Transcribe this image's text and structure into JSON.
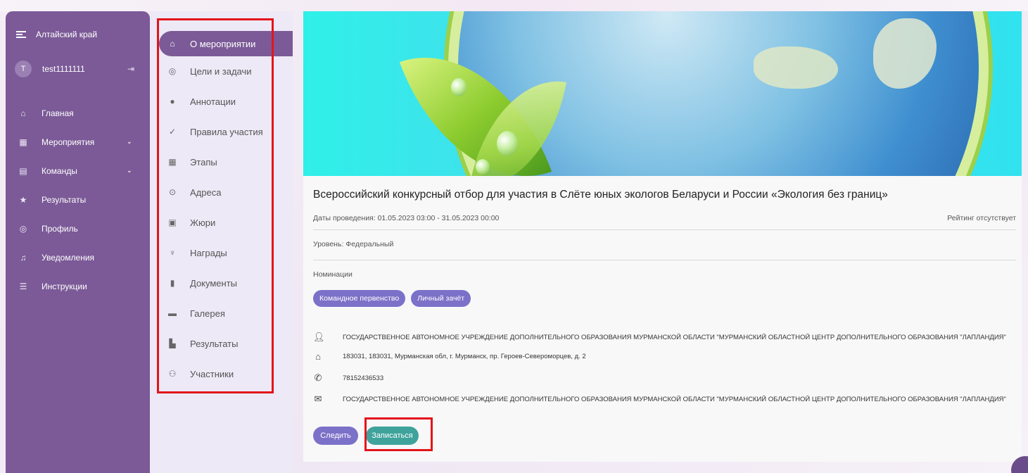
{
  "sidebar": {
    "region": "Алтайский край",
    "user": {
      "initial": "T",
      "name": "test1111111"
    },
    "items": [
      {
        "label": "Главная",
        "icon": "home-outline-icon"
      },
      {
        "label": "Мероприятия",
        "icon": "calendar-icon",
        "has_chevron": true
      },
      {
        "label": "Команды",
        "icon": "document-icon",
        "has_chevron": true
      },
      {
        "label": "Результаты",
        "icon": "star-person-icon"
      },
      {
        "label": "Профиль",
        "icon": "profile-icon"
      },
      {
        "label": "Уведомления",
        "icon": "bell-icon"
      },
      {
        "label": "Инструкции",
        "icon": "list-icon"
      }
    ]
  },
  "event_menu": {
    "items": [
      {
        "label": "О мероприятии",
        "icon": "home-icon",
        "active": true
      },
      {
        "label": "Цели и задачи",
        "icon": "target-icon"
      },
      {
        "label": "Аннотации",
        "icon": "info-icon"
      },
      {
        "label": "Правила участия",
        "icon": "check-icon"
      },
      {
        "label": "Этапы",
        "icon": "stages-icon"
      },
      {
        "label": "Адреса",
        "icon": "location-icon"
      },
      {
        "label": "Жюри",
        "icon": "jury-icon"
      },
      {
        "label": "Награды",
        "icon": "trophy-icon"
      },
      {
        "label": "Документы",
        "icon": "file-icon"
      },
      {
        "label": "Галерея",
        "icon": "image-icon"
      },
      {
        "label": "Результаты",
        "icon": "chart-icon"
      },
      {
        "label": "Участники",
        "icon": "people-icon"
      }
    ]
  },
  "event": {
    "title": "Всероссийский конкурсный отбор для участия в Слёте юных экологов Беларуси и России «Экология без границ»",
    "dates": "Даты проведения: 01.05.2023 03:00 - 31.05.2023 00:00",
    "rating": "Рейтинг отсутствует",
    "level": "Уровень: Федеральный",
    "nominations_label": "Номинации",
    "nominations": [
      "Командное первенство",
      "Личный зачёт"
    ],
    "organizer": "ГОСУДАРСТВЕННОЕ АВТОНОМНОЕ УЧРЕЖДЕНИЕ ДОПОЛНИТЕЛЬНОГО ОБРАЗОВАНИЯ МУРМАНСКОЙ ОБЛАСТИ \"МУРМАНСКИЙ ОБЛАСТНОЙ ЦЕНТР ДОПОЛНИТЕЛЬНОГО ОБРАЗОВАНИЯ \"ЛАПЛАНДИЯ\"",
    "address": "183031, 183031, Мурманская обл, г. Мурманск, пр. Героев-Североморцев, д. 2",
    "phone": "78152436533",
    "email_org": "ГОСУДАРСТВЕННОЕ АВТОНОМНОЕ УЧРЕЖДЕНИЕ ДОПОЛНИТЕЛЬНОГО ОБРАЗОВАНИЯ МУРМАНСКОЙ ОБЛАСТИ \"МУРМАНСКИЙ ОБЛАСТНОЙ ЦЕНТР ДОПОЛНИТЕЛЬНОГО ОБРАЗОВАНИЯ \"ЛАПЛАНДИЯ\""
  },
  "actions": {
    "follow_label": "Следить",
    "signup_label": "Записаться"
  },
  "colors": {
    "sidebar": "#7b5a97",
    "chip": "#7b71c8",
    "signup": "#3fa39c",
    "highlight": "#e3141b"
  }
}
